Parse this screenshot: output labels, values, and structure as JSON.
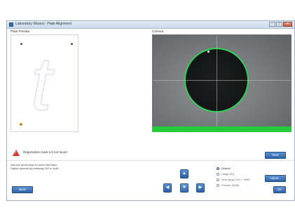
{
  "window": {
    "title": "Laboratory Wizard - Plate Alignment",
    "controls": {
      "minimize": "–",
      "maximize": "□",
      "close": "✕"
    }
  },
  "plate_preview": {
    "label": "Plate Preview",
    "glyph": "t"
  },
  "camera": {
    "label": "Camera",
    "status_color": "#22cc3a"
  },
  "status": {
    "icon": "warning-icon",
    "text": "Registration mark 1/3 not found"
  },
  "buttons": {
    "next": "Next",
    "back": "Back",
    "adjust": "Adjust...",
    "ok": "OK"
  },
  "hint": {
    "line1": "Use the arrow keys to move the laser.",
    "line2": "Higher speeds by pressing Ctrl or shift."
  },
  "arrows": {
    "up": "▲",
    "left": "◀",
    "center": "●",
    "down": "▼",
    "right": "▶"
  },
  "speed_options": {
    "selected": "Default",
    "items": [
      "Default",
      "Large (5x)",
      "Very large (Ctrl + Shift)",
      "Precise (Shift)"
    ]
  },
  "colors": {
    "accent": "#2f63a8",
    "warning": "#d9342b",
    "detected_outline": "#2fd15a"
  }
}
